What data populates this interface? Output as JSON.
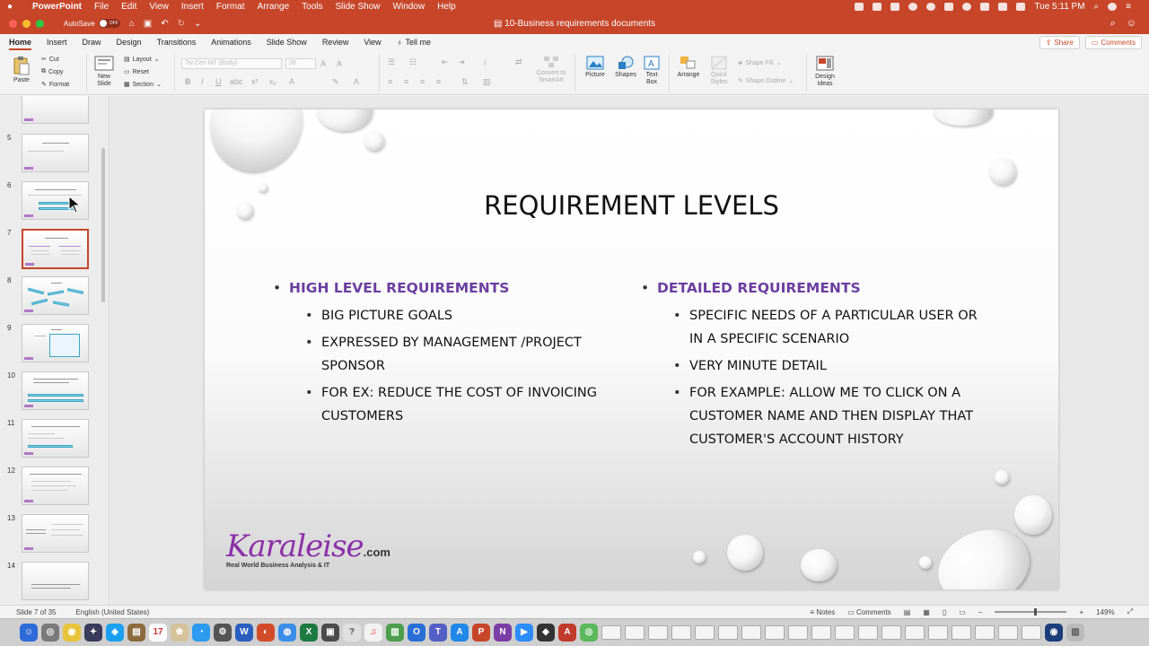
{
  "menubar": {
    "app": "PowerPoint",
    "items": [
      "File",
      "Edit",
      "View",
      "Insert",
      "Format",
      "Arrange",
      "Tools",
      "Slide Show",
      "Window",
      "Help"
    ],
    "clock": "Tue 5:11 PM"
  },
  "titlebar": {
    "autosave_label": "AutoSave",
    "autosave_state": "OFF",
    "doc_title": "10-Business requirements documents"
  },
  "tabs": {
    "items": [
      "Home",
      "Insert",
      "Draw",
      "Design",
      "Transitions",
      "Animations",
      "Slide Show",
      "Review",
      "View"
    ],
    "tell_me": "Tell me",
    "share": "Share",
    "comments": "Comments"
  },
  "ribbon": {
    "paste": "Paste",
    "cut": "Cut",
    "copy": "Copy",
    "format": "Format",
    "new_slide": "New Slide",
    "layout": "Layout",
    "reset": "Reset",
    "section": "Section",
    "font_name": "Tw Cen MT (Body)",
    "font_size": "28",
    "convert_smartart": "Convert to SmartArt",
    "picture": "Picture",
    "shapes": "Shapes",
    "text_box": "Text Box",
    "arrange": "Arrange",
    "quick_styles": "Quick Styles",
    "shape_fill": "Shape Fill",
    "shape_outline": "Shape Outline",
    "design_ideas": "Design Ideas"
  },
  "thumbnails": [
    "5",
    "6",
    "7",
    "8",
    "9",
    "10",
    "11",
    "12",
    "13",
    "14"
  ],
  "slide": {
    "title": "REQUIREMENT LEVELS",
    "left": {
      "heading": "HIGH LEVEL REQUIREMENTS",
      "bullets": [
        "BIG PICTURE GOALS",
        "EXPRESSED BY MANAGEMENT /PROJECT SPONSOR",
        "FOR EX: REDUCE THE COST OF INVOICING CUSTOMERS"
      ]
    },
    "right": {
      "heading": "DETAILED REQUIREMENTS",
      "bullets": [
        "SPECIFIC NEEDS OF A PARTICULAR USER OR IN A SPECIFIC SCENARIO",
        "VERY MINUTE DETAIL",
        "FOR EXAMPLE: ALLOW ME TO CLICK ON A CUSTOMER NAME AND THEN DISPLAY THAT CUSTOMER'S ACCOUNT HISTORY"
      ]
    },
    "logo_brand": "Karaleise",
    "logo_dotcom": ".com",
    "logo_tagline": "Real World Business Analysis & IT"
  },
  "statusbar": {
    "slide_count": "Slide 7 of 35",
    "language": "English (United States)",
    "notes": "Notes",
    "comments": "Comments",
    "zoom": "149%"
  },
  "colors": {
    "accent": "#c7462a",
    "heading_purple": "#6b3fa0",
    "logo_purple": "#8b2fa8"
  }
}
